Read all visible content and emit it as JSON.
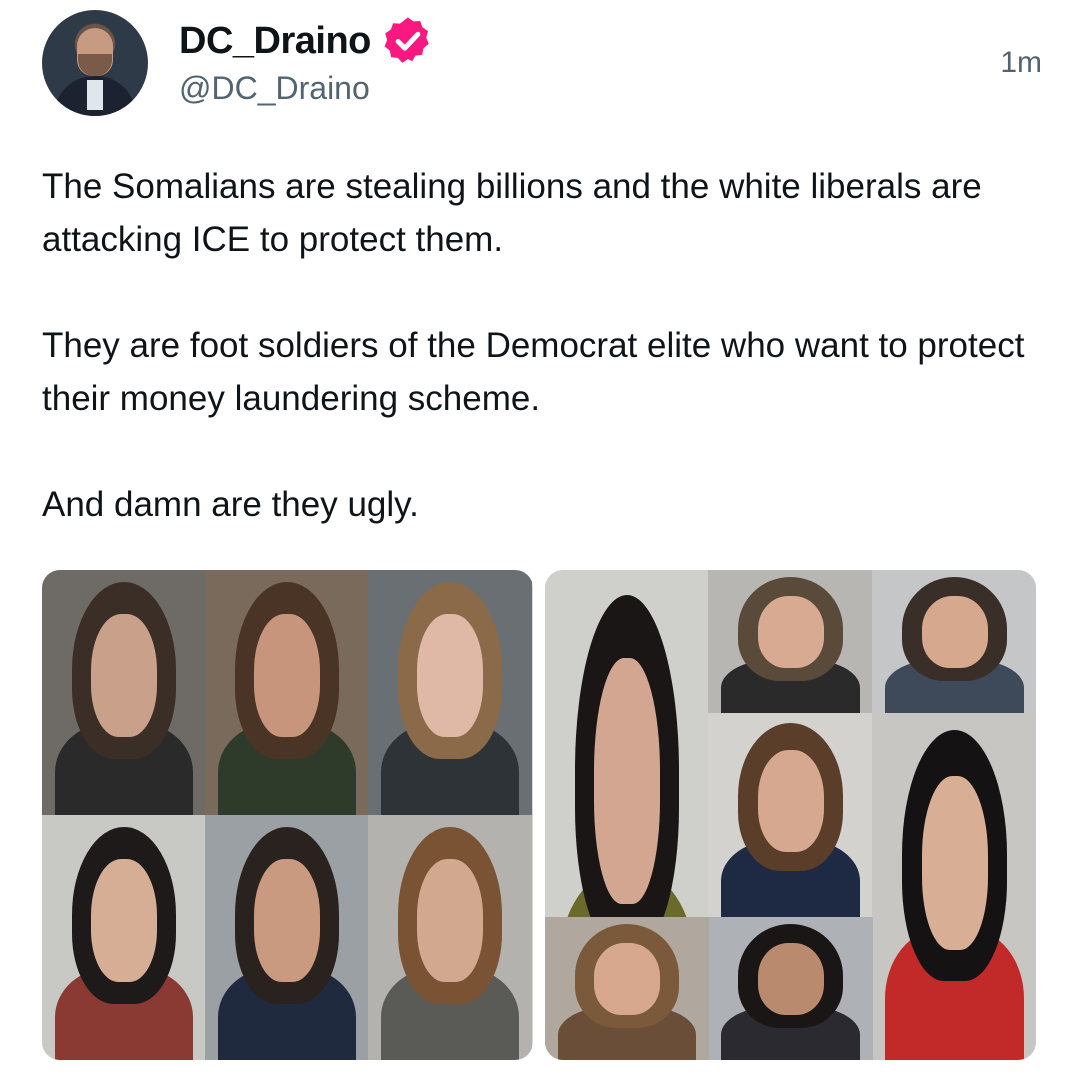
{
  "post": {
    "display_name": "DC_Draino",
    "handle": "@DC_Draino",
    "time": "1m",
    "paragraphs": [
      "The Somalians are stealing billions and the white liberals are attacking ICE to protect them.",
      "They are foot soldiers of the Democrat elite who want to protect their money laundering scheme.",
      "And damn are they ugly."
    ]
  },
  "icons": {
    "verified": "verified-badge-icon",
    "avatar": "profile-avatar"
  },
  "colors": {
    "verified_badge": "#f91880",
    "text_primary": "#0f1419",
    "text_secondary": "#536471"
  },
  "media": {
    "image_count": 2
  }
}
